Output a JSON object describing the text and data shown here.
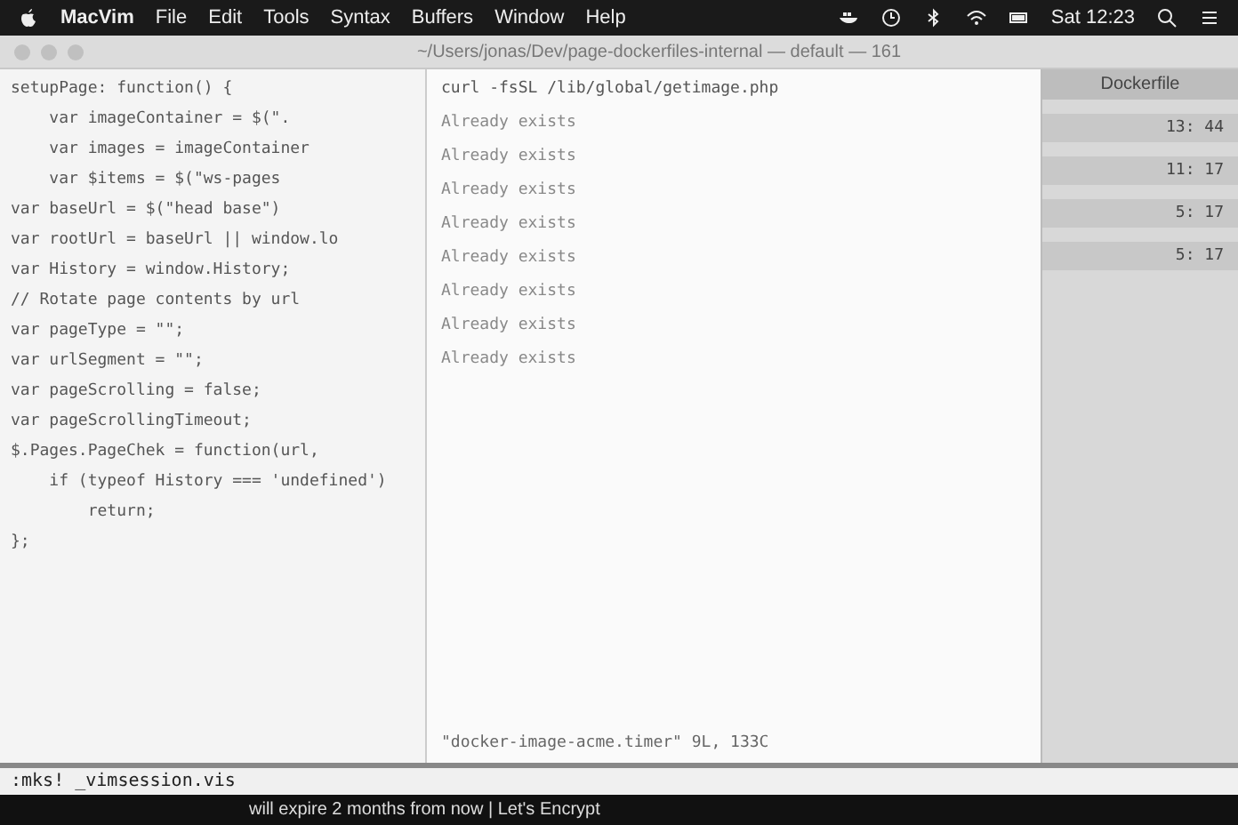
{
  "menu_bar": {
    "app": "MacVim",
    "menus": [
      "File",
      "Edit",
      "Tools",
      "Syntax",
      "Buffers",
      "Window",
      "Help"
    ],
    "clock": "Sat 12:23"
  },
  "window": {
    "title": "~/Users/jonas/Dev/page-dockerfiles-internal — default — 161"
  },
  "editor": {
    "lines": [
      "setupPage: function() {",
      "    var imageContainer = $(\".",
      "    var images = imageContainer",
      "    var $items = $(\"ws-pages",
      "var baseUrl = $(\"head base\")",
      "var rootUrl = baseUrl || window.lo",
      "var History = window.History;",
      "// Rotate page contents by url",
      "var pageType = \"\";",
      "var urlSegment = \"\";",
      "var pageScrolling = false;",
      "var pageScrollingTimeout;",
      "$.Pages.PageChek = function(url,",
      "    if (typeof History === 'undefined')",
      "        return;",
      "};"
    ],
    "command": ":mks! _vimsession.vis"
  },
  "terminal": {
    "command": "curl -fsSL /lib/global/getimage.php",
    "lines": [
      "Already exists",
      "Already exists",
      "Already exists",
      "Already exists",
      "Already exists",
      "Already exists",
      "Already exists",
      "Already exists"
    ],
    "file_info": "\"docker-image-acme.timer\" 9L, 133C"
  },
  "dockerfile_panel": {
    "title": "Dockerfile",
    "times": [
      "13: 44",
      "11: 17",
      "5: 17",
      "5: 17"
    ]
  },
  "notice": "will expire 2 months from now | Let's Encrypt"
}
